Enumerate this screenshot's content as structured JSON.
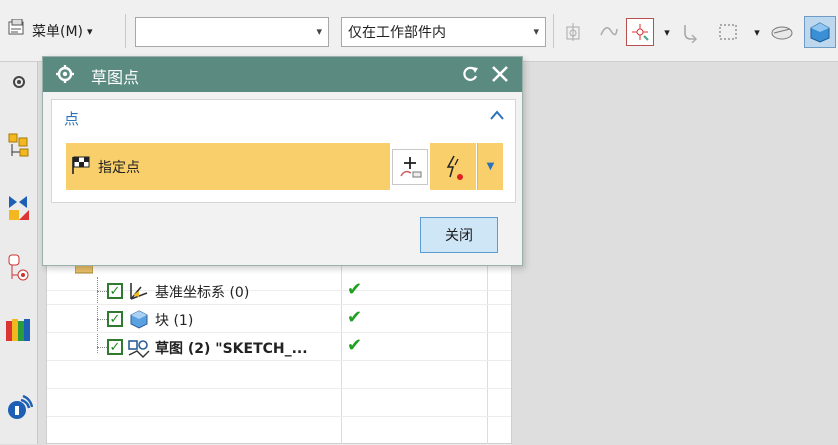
{
  "toolbar": {
    "menu_label": "菜单(M)",
    "menu_arrow": "▾",
    "filter_combo": {
      "value": "",
      "arrow": "▾"
    },
    "scope_combo": {
      "value": "仅在工作部件内",
      "arrow": "▾"
    },
    "small_arrow": "▾"
  },
  "dialog": {
    "title": "草图点",
    "group_label": "点",
    "point_field_label": "指定点",
    "close_button": "关闭"
  },
  "nav_tree": {
    "rows": [
      {
        "label": "基准坐标系 (0)",
        "bold": false,
        "checked": "✓",
        "status": "✔"
      },
      {
        "label": "块 (1)",
        "bold": false,
        "checked": "✓",
        "status": "✔"
      },
      {
        "label": "草图 (2) \"SKETCH_...",
        "bold": true,
        "checked": "✓",
        "status": "✔"
      }
    ]
  }
}
